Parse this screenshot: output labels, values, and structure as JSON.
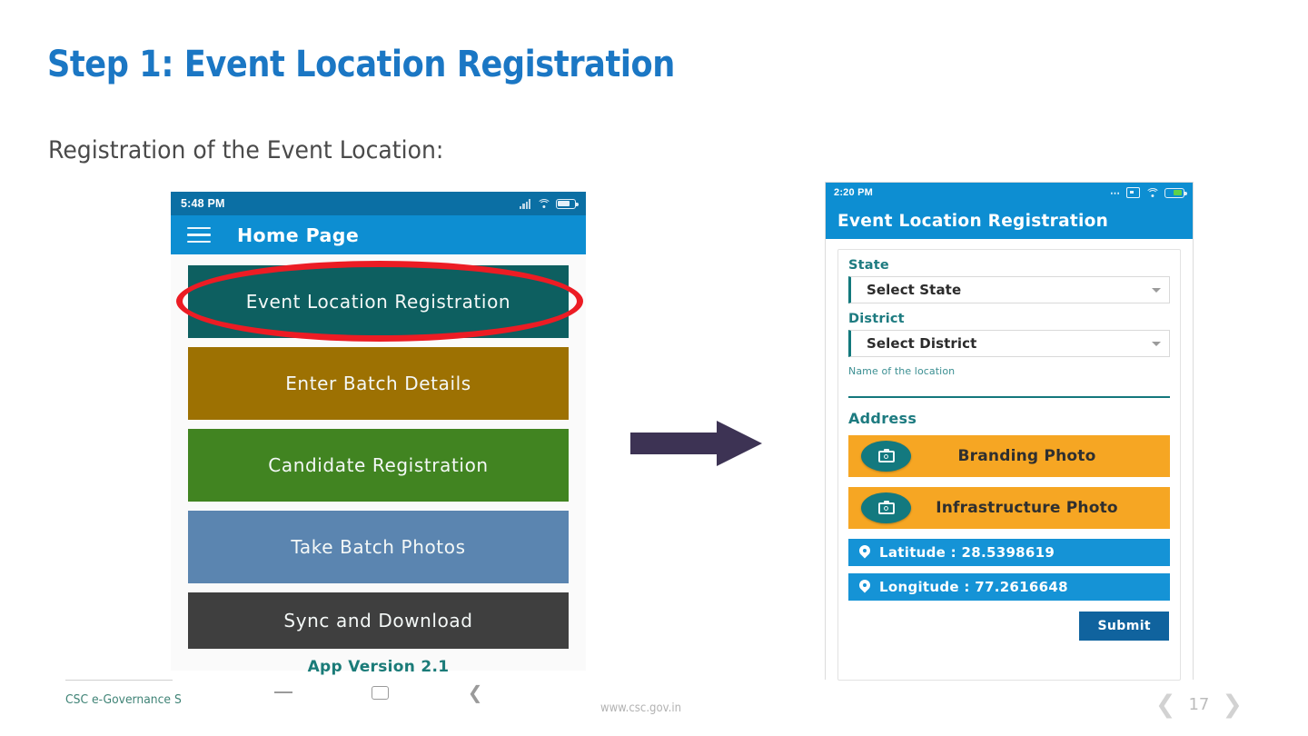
{
  "slide": {
    "title": "Step 1: Event Location Registration",
    "subtitle": "Registration of  the Event Location:",
    "title_color": "#1b77c4"
  },
  "phone_home": {
    "status": {
      "time": "5:48 PM",
      "icons": [
        "signal-icon",
        "wifi-icon",
        "battery-icon"
      ]
    },
    "appbar": {
      "menu_icon": "hamburger-icon",
      "title": "Home Page"
    },
    "menu_items": [
      {
        "label": "Event Location Registration",
        "color": "#0d5f60",
        "highlighted": true
      },
      {
        "label": "Enter Batch Details",
        "color": "#9d7102",
        "highlighted": false
      },
      {
        "label": "Candidate Registration",
        "color": "#418421",
        "highlighted": false
      },
      {
        "label": "Take Batch Photos",
        "color": "#5b85b0",
        "highlighted": false
      },
      {
        "label": "Sync and Download",
        "color": "#3f3f3f",
        "highlighted": false
      }
    ],
    "app_version": "App Version 2.1",
    "nav_bar": [
      "recents-dash-icon",
      "home-square-icon",
      "back-chevron-icon"
    ]
  },
  "phone_form": {
    "status": {
      "time": "2:20 PM",
      "icons": [
        "dots-icon",
        "screenshot-icon",
        "wifi-icon",
        "battery-charging-icon"
      ]
    },
    "appbar": {
      "title": "Event Location Registration"
    },
    "fields": {
      "state_label": "State",
      "state_value": "Select State",
      "district_label": "District",
      "district_value": "Select District",
      "location_name_label": "Name of the location",
      "location_name_value": "",
      "address_label": "Address"
    },
    "photo_buttons": [
      {
        "label": "Branding Photo",
        "icon": "camera-icon"
      },
      {
        "label": "Infrastructure Photo",
        "icon": "camera-icon"
      }
    ],
    "coordinates": [
      {
        "label": "Latitude : 28.5398619",
        "icon": "location-pin-icon"
      },
      {
        "label": "Longitude : 77.2616648",
        "icon": "location-pin-icon"
      }
    ],
    "submit_label": "Submit",
    "colors": {
      "appbar": "#0d8ed2",
      "photo_button": "#f6a623",
      "coord_row": "#1593d6",
      "submit": "#10639e",
      "accent_teal": "#13797f"
    }
  },
  "arrow": {
    "color": "#3d3354",
    "direction": "right"
  },
  "footer": {
    "left": "CSC e-Governance S",
    "center": "www.csc.gov.in",
    "page_number": "17",
    "prev_icon": "chevron-left-icon",
    "next_icon": "chevron-right-icon"
  }
}
